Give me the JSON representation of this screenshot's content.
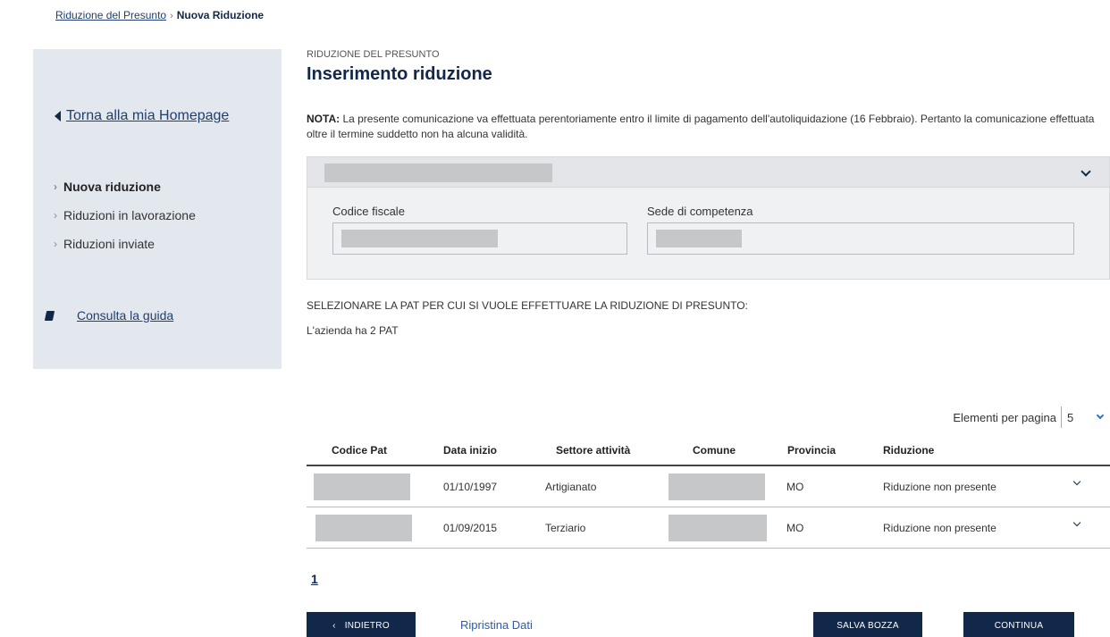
{
  "breadcrumb": {
    "parent": "Riduzione del Presunto",
    "separator": "›",
    "current": "Nuova Riduzione"
  },
  "sidebar": {
    "back_link": "Torna alla mia Homepage",
    "items": [
      {
        "label": "Nuova riduzione",
        "active": true
      },
      {
        "label": "Riduzioni in lavorazione",
        "active": false
      },
      {
        "label": "Riduzioni inviate",
        "active": false
      }
    ],
    "guide_link": "Consulta la guida"
  },
  "header": {
    "overline": "RIDUZIONE DEL PRESUNTO",
    "title": "Inserimento riduzione"
  },
  "note": {
    "label": "NOTA:",
    "text": " La presente comunicazione va effettuata perentoriamente entro il limite di pagamento dell'autoliquidazione (16 Febbraio). Pertanto la comunicazione effettuata oltre il termine suddetto non ha alcuna validità."
  },
  "company_panel": {
    "fields": {
      "codice_fiscale_label": "Codice fiscale",
      "sede_label": "Sede di competenza"
    }
  },
  "pat_section": {
    "instruction": "SELEZIONARE LA PAT PER CUI SI VUOLE EFFETTUARE LA RIDUZIONE DI PRESUNTO:",
    "count_text": "L'azienda ha 2 PAT"
  },
  "pagination": {
    "per_page_label": "Elementi per pagina",
    "per_page_value": "5",
    "current_page": "1"
  },
  "table": {
    "headers": [
      "Codice Pat",
      "Data inizio",
      "Settore attività",
      "Comune",
      "Provincia",
      "Riduzione"
    ],
    "rows": [
      {
        "data_inizio": "01/10/1997",
        "settore": "Artigianato",
        "provincia": "MO",
        "riduzione": "Riduzione non presente"
      },
      {
        "data_inizio": "01/09/2015",
        "settore": "Terziario",
        "provincia": "MO",
        "riduzione": "Riduzione non presente"
      }
    ]
  },
  "actions": {
    "back": "INDIETRO",
    "back_glyph": "‹",
    "reset": "Ripristina Dati",
    "save_draft": "SALVA BOZZA",
    "continue": "CONTINUA"
  }
}
